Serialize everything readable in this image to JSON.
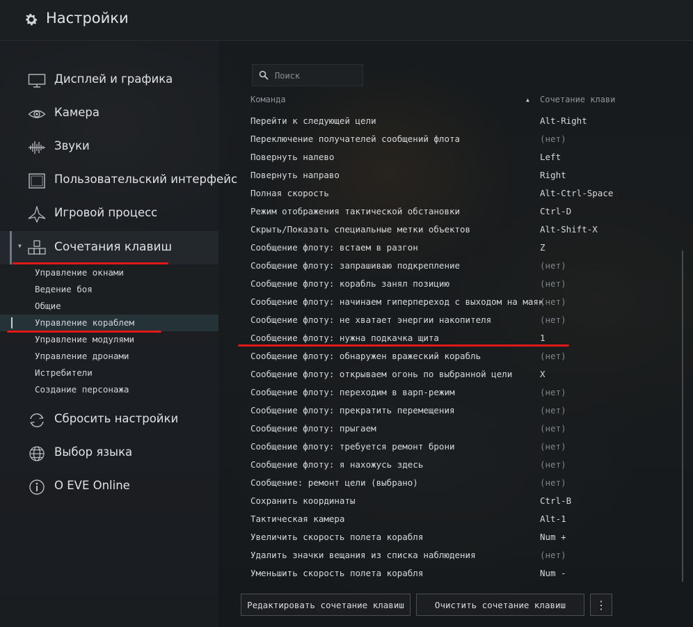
{
  "window": {
    "title": "Настройки"
  },
  "sidebar": {
    "items": [
      {
        "label": "Дисплей и графика",
        "icon": "monitor-icon"
      },
      {
        "label": "Камера",
        "icon": "eye-icon"
      },
      {
        "label": "Звуки",
        "icon": "sound-wave-icon"
      },
      {
        "label": "Пользовательский интерфейс",
        "icon": "window-icon"
      },
      {
        "label": "Игровой процесс",
        "icon": "spaceship-icon"
      },
      {
        "label": "Сочетания клавиш",
        "icon": "keys-icon",
        "expanded": true
      }
    ],
    "sub_items": [
      {
        "label": "Управление окнами"
      },
      {
        "label": "Ведение боя"
      },
      {
        "label": "Общие"
      },
      {
        "label": "Управление кораблем",
        "selected": true
      },
      {
        "label": "Управление модулями"
      },
      {
        "label": "Управление дронами"
      },
      {
        "label": "Истребители"
      },
      {
        "label": "Создание персонажа"
      }
    ],
    "bottom_items": [
      {
        "label": "Сбросить настройки",
        "icon": "reset-icon"
      },
      {
        "label": "Выбор языка",
        "icon": "globe-icon"
      },
      {
        "label": "О EVE Online",
        "icon": "info-icon"
      }
    ]
  },
  "search": {
    "placeholder": "Поиск",
    "value": ""
  },
  "table": {
    "columns": {
      "command": "Команда",
      "shortcut": "Сочетание клави"
    },
    "sort": "shortcut-ascending",
    "rows": [
      {
        "command": "Перейти к следующей цели",
        "shortcut": "Alt-Right"
      },
      {
        "command": "Переключение получателей сообщений флота",
        "shortcut": "(нет)"
      },
      {
        "command": "Повернуть налево",
        "shortcut": "Left"
      },
      {
        "command": "Повернуть направо",
        "shortcut": "Right"
      },
      {
        "command": "Полная скорость",
        "shortcut": "Alt-Ctrl-Space"
      },
      {
        "command": "Режим отображения тактической обстановки",
        "shortcut": "Ctrl-D"
      },
      {
        "command": "Скрыть/Показать специальные метки объектов",
        "shortcut": "Alt-Shift-X"
      },
      {
        "command": "Сообщение флоту: встаем в разгон",
        "shortcut": "Z"
      },
      {
        "command": "Сообщение флоту: запрашиваю подкрепление",
        "shortcut": "(нет)"
      },
      {
        "command": "Сообщение флоту: корабль занял позицию",
        "shortcut": "(нет)"
      },
      {
        "command": "Сообщение флоту: начинаем гиперпереход с выходом на маяк",
        "shortcut": "(нет)"
      },
      {
        "command": "Сообщение флоту: не хватает энергии накопителя",
        "shortcut": "(нет)"
      },
      {
        "command": "Сообщение флоту: нужна подкачка щита",
        "shortcut": "1"
      },
      {
        "command": "Сообщение флоту: обнаружен вражеский корабль",
        "shortcut": "(нет)"
      },
      {
        "command": "Сообщение флоту: открываем огонь по выбранной цели",
        "shortcut": "X"
      },
      {
        "command": "Сообщение флоту: переходим в варп-режим",
        "shortcut": "(нет)"
      },
      {
        "command": "Сообщение флоту: прекратить перемещения",
        "shortcut": "(нет)"
      },
      {
        "command": "Сообщение флоту: прыгаем",
        "shortcut": "(нет)"
      },
      {
        "command": "Сообщение флоту: требуется ремонт брони",
        "shortcut": "(нет)"
      },
      {
        "command": "Сообщение флоту: я нахожусь здесь",
        "shortcut": "(нет)"
      },
      {
        "command": "Сообщение: ремонт цели (выбрано)",
        "shortcut": "(нет)"
      },
      {
        "command": "Сохранить координаты",
        "shortcut": "Ctrl-B"
      },
      {
        "command": "Тактическая камера",
        "shortcut": "Alt-1"
      },
      {
        "command": "Увеличить скорость полета корабля",
        "shortcut": "Num +"
      },
      {
        "command": "Удалить значки вещания из списка наблюдения",
        "shortcut": "(нет)"
      },
      {
        "command": "Уменьшить скорость полета корабля",
        "shortcut": "Num -"
      }
    ]
  },
  "buttons": {
    "edit": "Редактировать сочетание клавиш",
    "clear": "Очистить сочетание клавиш",
    "more": "⋮"
  },
  "annotations": {
    "underline_color": "#e01818"
  }
}
